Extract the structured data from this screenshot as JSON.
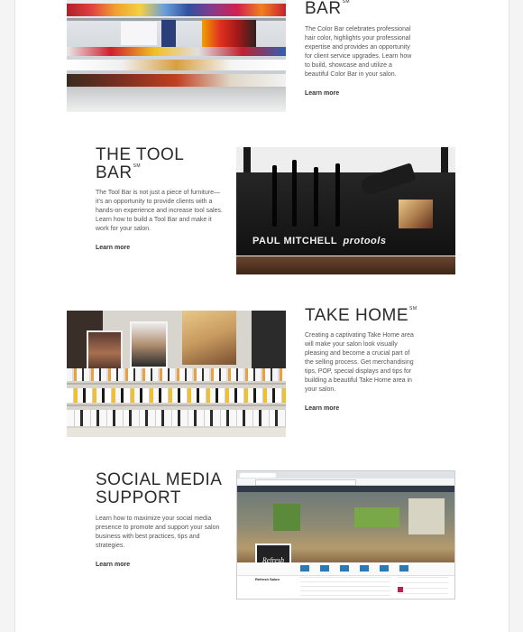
{
  "sections": {
    "color_bar": {
      "title": "BAR",
      "sm": "SM",
      "body": "The Color Bar celebrates professional hair color, highlights your professional expertise and provides an opportunity for client service upgrades. Learn how to build, showcase and utilize a beautiful Color Bar in your salon.",
      "link": "Learn more"
    },
    "tool_bar": {
      "title": "THE TOOL BAR",
      "sm": "SM",
      "body": "The Tool Bar is not just a piece of furniture—it's an opportunity to provide clients with a hands-on experience and increase tool sales. Learn how to build a Tool Bar and make it work for your salon.",
      "link": "Learn more",
      "image_brand": "PAUL MITCHELL",
      "image_brand2": "protools"
    },
    "take_home": {
      "title": "TAKE HOME",
      "sm": "SM",
      "body": "Creating a captivating Take Home area will make your salon look visually pleasing and become a crucial part of the selling process. Get merchandising tips, POP, special displays and tips for building a beautiful Take Home area in your salon.",
      "link": "Learn more"
    },
    "social_media": {
      "title_line1": "SOCIAL MEDIA",
      "title_line2": "SUPPORT",
      "body": "Learn how to maximize your social media presence to promote and support your salon business with best practices, tips and strategies.",
      "link": "Learn more",
      "profile_logo": "Refresh",
      "profile_name": "Refresh Salon"
    }
  },
  "colors": {
    "page_bg": "#ffffff",
    "outer_bg": "#f4f4f4",
    "title": "#2b2b2b",
    "body": "#555555"
  }
}
